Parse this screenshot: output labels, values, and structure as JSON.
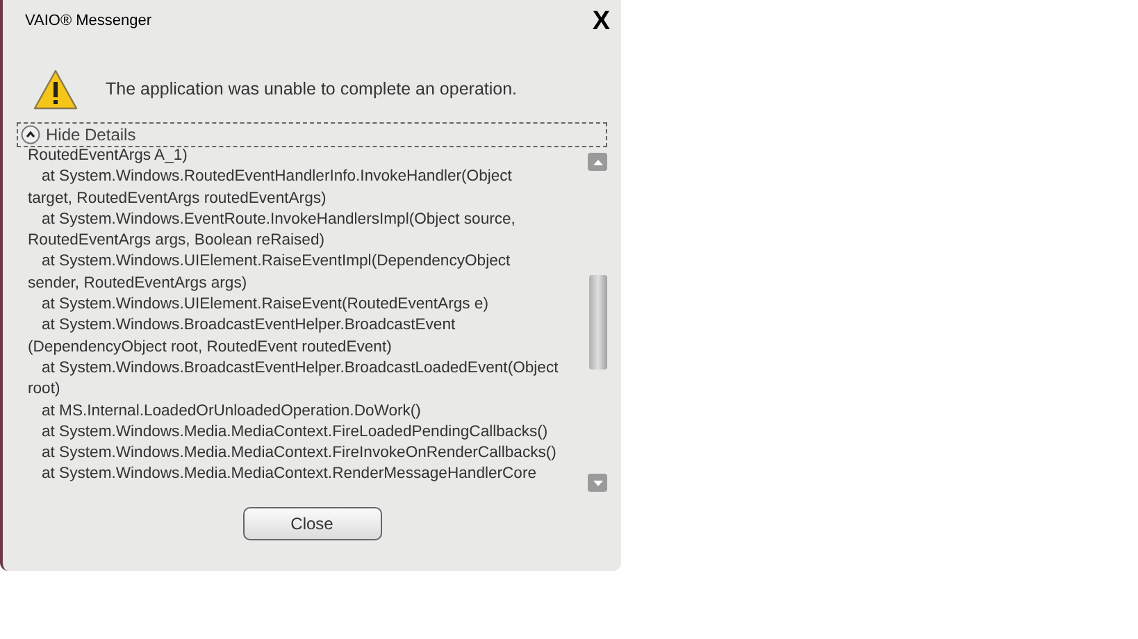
{
  "window": {
    "title": "VAIO® Messenger",
    "close": "X"
  },
  "message": "The application was unable to complete an operation.",
  "details_toggle": {
    "label": "Hide Details",
    "expanded": true
  },
  "details_lines": [
    {
      "text": "RoutedEventArgs A_1)",
      "indent": false
    },
    {
      "text": "at System.Windows.RoutedEventHandlerInfo.InvokeHandler(Object",
      "indent": true
    },
    {
      "text": "target, RoutedEventArgs routedEventArgs)",
      "indent": false
    },
    {
      "text": "at System.Windows.EventRoute.InvokeHandlersImpl(Object source,",
      "indent": true
    },
    {
      "text": "RoutedEventArgs args, Boolean reRaised)",
      "indent": false
    },
    {
      "text": "at System.Windows.UIElement.RaiseEventImpl(DependencyObject",
      "indent": true
    },
    {
      "text": "sender, RoutedEventArgs args)",
      "indent": false
    },
    {
      "text": "at System.Windows.UIElement.RaiseEvent(RoutedEventArgs e)",
      "indent": true
    },
    {
      "text": "at System.Windows.BroadcastEventHelper.BroadcastEvent",
      "indent": true
    },
    {
      "text": "(DependencyObject root, RoutedEvent routedEvent)",
      "indent": false
    },
    {
      "text": "at System.Windows.BroadcastEventHelper.BroadcastLoadedEvent(Object",
      "indent": true
    },
    {
      "text": "root)",
      "indent": false
    },
    {
      "text": "at MS.Internal.LoadedOrUnloadedOperation.DoWork()",
      "indent": true
    },
    {
      "text": "at System.Windows.Media.MediaContext.FireLoadedPendingCallbacks()",
      "indent": true
    },
    {
      "text": "at System.Windows.Media.MediaContext.FireInvokeOnRenderCallbacks()",
      "indent": true
    },
    {
      "text": "at System.Windows.Media.MediaContext.RenderMessageHandlerCore",
      "indent": true
    }
  ],
  "buttons": [
    "Close"
  ]
}
